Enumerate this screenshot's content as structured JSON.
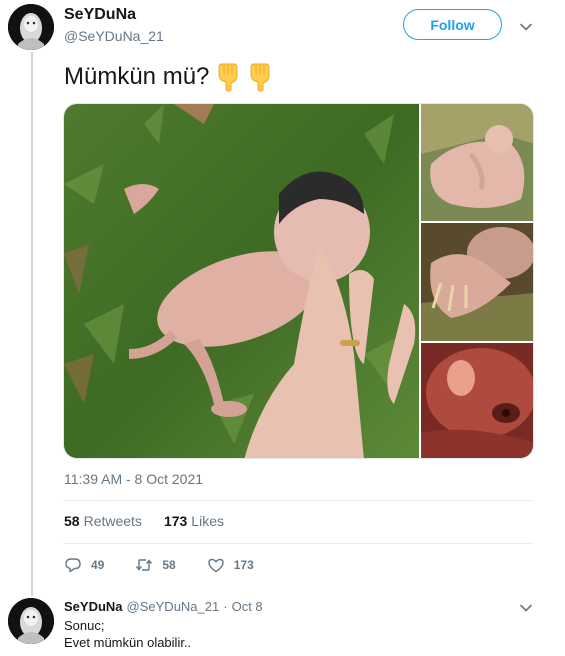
{
  "tweet": {
    "author": {
      "display_name": "SeYDuNa",
      "handle": "@SeYDuNa_21"
    },
    "follow_label": "Follow",
    "text": "Mümkün mü?",
    "emojis": [
      "backhand-index-pointing-down",
      "backhand-index-pointing-down"
    ],
    "timestamp": "11:39 AM - 8 Oct 2021",
    "stats": {
      "retweets_count": "58",
      "retweets_label": "Retweets",
      "likes_count": "173",
      "likes_label": "Likes"
    },
    "actions": {
      "reply_count": "49",
      "retweet_count": "58",
      "like_count": "173"
    },
    "media": [
      "photo-1",
      "photo-2",
      "photo-3",
      "photo-4"
    ]
  },
  "reply": {
    "display_name": "SeYDuNa",
    "handle": "@SeYDuNa_21",
    "separator": "·",
    "date": "Oct 8",
    "lines": [
      "Sonuc;",
      "Evet mümkün olabilir.."
    ]
  },
  "colors": {
    "accent": "#1da1f2",
    "text_primary": "#14171a",
    "text_secondary": "#657786",
    "divider": "#e6ecf0",
    "thread_line": "#ccd6dd"
  }
}
